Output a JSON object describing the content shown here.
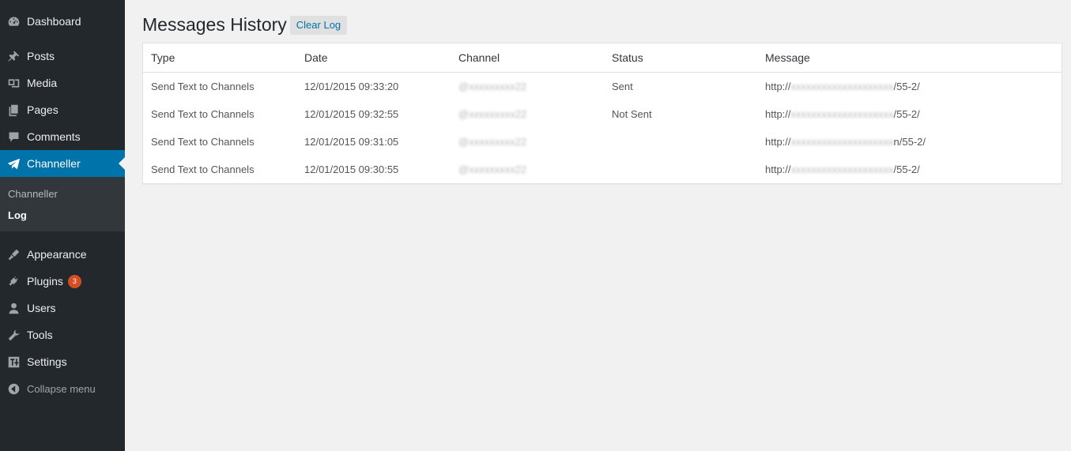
{
  "sidebar": {
    "items": [
      {
        "label": "Dashboard",
        "icon": "dashboard-icon"
      },
      {
        "label": "Posts",
        "icon": "pin-icon"
      },
      {
        "label": "Media",
        "icon": "media-icon"
      },
      {
        "label": "Pages",
        "icon": "pages-icon"
      },
      {
        "label": "Comments",
        "icon": "comment-icon"
      },
      {
        "label": "Channeller",
        "icon": "paper-plane-icon"
      },
      {
        "label": "Appearance",
        "icon": "brush-icon"
      },
      {
        "label": "Plugins",
        "icon": "plug-icon",
        "badge": "3"
      },
      {
        "label": "Users",
        "icon": "user-icon"
      },
      {
        "label": "Tools",
        "icon": "wrench-icon"
      },
      {
        "label": "Settings",
        "icon": "settings-icon"
      }
    ],
    "submenu": [
      {
        "label": "Channeller"
      },
      {
        "label": "Log"
      }
    ],
    "collapse_label": "Collapse menu",
    "active_color": "#0073aa",
    "badge_color": "#d54e21"
  },
  "main": {
    "title": "Messages History",
    "clear_button": "Clear Log",
    "columns": [
      "Type",
      "Date",
      "Channel",
      "Status",
      "Message"
    ],
    "rows": [
      {
        "type": "Send Text to Channels",
        "date": "12/01/2015 09:33:20",
        "channel": "@xxxxxxxxx22",
        "status": "Sent",
        "message_prefix": "http://",
        "message_hidden": "xxxxxxxxxxxxxxxxxxxx",
        "message_suffix": "/55-2/"
      },
      {
        "type": "Send Text to Channels",
        "date": "12/01/2015 09:32:55",
        "channel": "@xxxxxxxxx22",
        "status": "Not Sent",
        "message_prefix": "http://",
        "message_hidden": "xxxxxxxxxxxxxxxxxxxx",
        "message_suffix": "/55-2/"
      },
      {
        "type": "Send Text to Channels",
        "date": "12/01/2015 09:31:05",
        "channel": "@xxxxxxxxx22",
        "status": "",
        "message_prefix": "http://",
        "message_hidden": "xxxxxxxxxxxxxxxxxxxx",
        "message_suffix": "n/55-2/"
      },
      {
        "type": "Send Text to Channels",
        "date": "12/01/2015 09:30:55",
        "channel": "@xxxxxxxxx22",
        "status": "",
        "message_prefix": "http://",
        "message_hidden": "xxxxxxxxxxxxxxxxxxxx",
        "message_suffix": "/55-2/"
      }
    ]
  }
}
